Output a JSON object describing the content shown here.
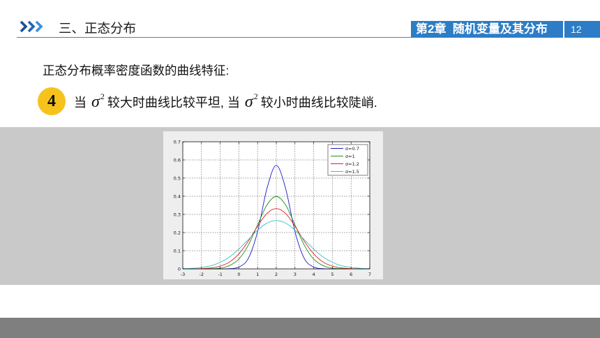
{
  "header": {
    "icon": "triple-chevron-right-icon",
    "section_title": "三、正态分布",
    "chapter_label": "第2章  随机变量及其分布",
    "page_number": "12",
    "accent_color": "#2c7dc6"
  },
  "content": {
    "subtitle": "正态分布概率密度函数的曲线特征:",
    "point": {
      "number": "4",
      "badge_color": "#f7c21c",
      "text_1": "当",
      "symbol_1": "σ",
      "exponent_1": "2",
      "text_2": "较大时曲线比较平坦, 当",
      "symbol_2": "σ",
      "exponent_2": "2",
      "text_3": "较小时曲线比较陡峭."
    }
  },
  "chart_data": {
    "type": "line",
    "xlim": [
      -3,
      7
    ],
    "ylim": [
      0,
      0.7
    ],
    "x_tick_labels": [
      "-3",
      "-2",
      "-1",
      "0",
      "1",
      "2",
      "3",
      "4",
      "5",
      "6",
      "7"
    ],
    "y_tick_labels": [
      "0",
      "0.1",
      "0.2",
      "0.3",
      "0.4",
      "0.5",
      "0.6",
      "0.7"
    ],
    "grid": true,
    "grid_style": "dotted",
    "legend_position": "top-right",
    "x": [
      -3,
      -2.5,
      -2,
      -1.5,
      -1,
      -0.5,
      0,
      0.5,
      1,
      1.5,
      2,
      2.5,
      3,
      3.5,
      4,
      4.5,
      5,
      5.5,
      6,
      6.5,
      7
    ],
    "series": [
      {
        "name": "σ=0.7",
        "color": "#1a1acc",
        "values": [
          0,
          0,
          0,
          0,
          0,
          0.001,
          0.01,
          0.057,
          0.205,
          0.442,
          0.57,
          0.442,
          0.205,
          0.057,
          0.01,
          0.001,
          0,
          0,
          0,
          0,
          0
        ]
      },
      {
        "name": "σ=1",
        "color": "#1f8f1f",
        "values": [
          0,
          0,
          0,
          0.001,
          0.004,
          0.018,
          0.054,
          0.13,
          0.242,
          0.352,
          0.399,
          0.352,
          0.242,
          0.13,
          0.054,
          0.018,
          0.004,
          0.001,
          0,
          0,
          0
        ]
      },
      {
        "name": "σ=1.2",
        "color": "#e02020",
        "values": [
          0,
          0,
          0.001,
          0.005,
          0.015,
          0.038,
          0.083,
          0.152,
          0.235,
          0.305,
          0.332,
          0.305,
          0.235,
          0.152,
          0.083,
          0.038,
          0.015,
          0.005,
          0.001,
          0,
          0
        ]
      },
      {
        "name": "σ=1.5",
        "color": "#2ec4c4",
        "values": [
          0.001,
          0.003,
          0.008,
          0.017,
          0.036,
          0.066,
          0.109,
          0.161,
          0.213,
          0.252,
          0.266,
          0.252,
          0.213,
          0.161,
          0.109,
          0.066,
          0.036,
          0.017,
          0.008,
          0.003,
          0.001
        ]
      }
    ]
  }
}
